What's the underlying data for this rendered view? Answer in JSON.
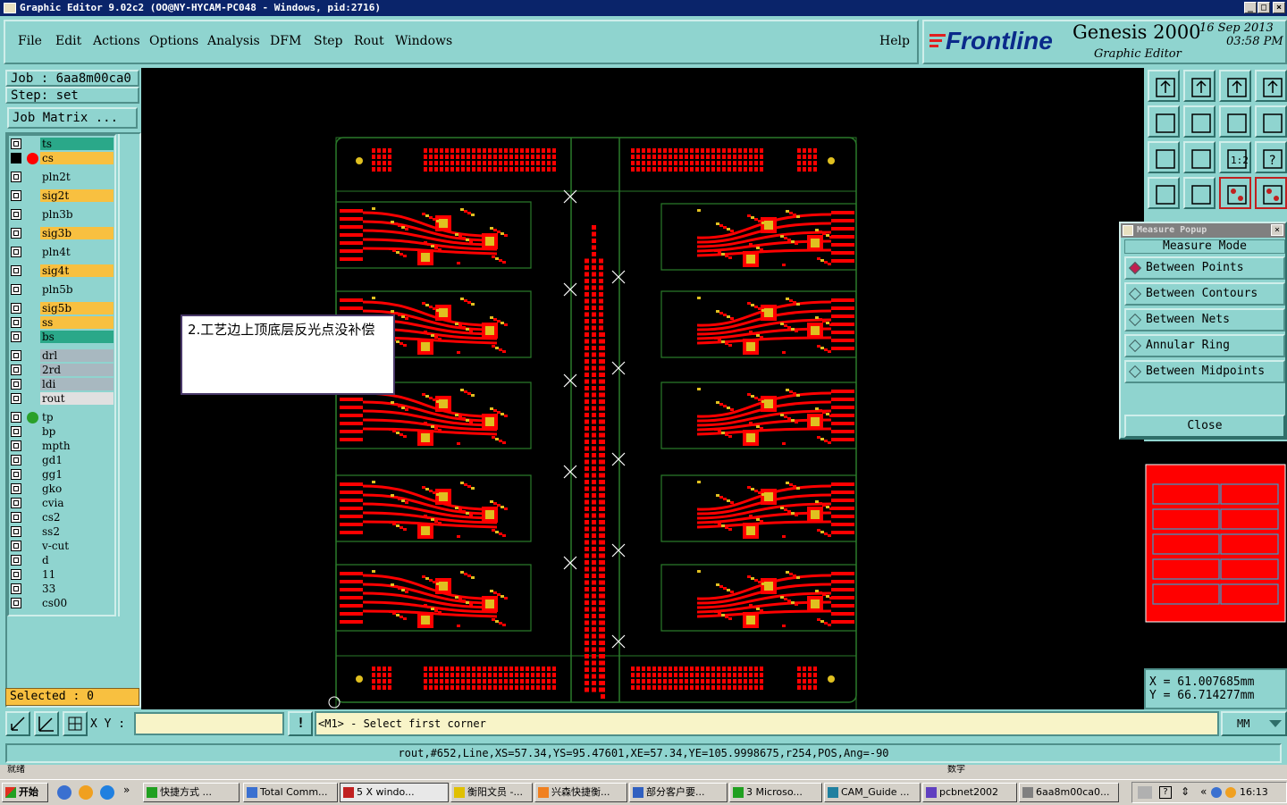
{
  "window": {
    "title": "Graphic Editor 9.02c2 (OO@NY-HYCAM-PC048 - Windows, pid:2716)"
  },
  "menu": [
    "File",
    "Edit",
    "Actions",
    "Options",
    "Analysis",
    "DFM",
    "Step",
    "Rout",
    "Windows"
  ],
  "menu_help": "Help",
  "brand": {
    "logo": "Frontline",
    "product": "Genesis 2000",
    "subtitle": "Graphic Editor",
    "date": "16 Sep 2013",
    "time": "03:58 PM"
  },
  "job": {
    "job_label": "Job : 6aa8m00ca0",
    "step_label": "Step: set",
    "matrix_button": "Job Matrix ..."
  },
  "layers": [
    {
      "name": "ts",
      "bg": "#2aa889",
      "dot": ""
    },
    {
      "name": "cs",
      "bg": "#f8c040",
      "dot": "#ff0000",
      "active": true
    },
    {
      "name": "pln2t",
      "bg": "#8fd4cf",
      "dot": ""
    },
    {
      "name": "sig2t",
      "bg": "#f8c040",
      "dot": ""
    },
    {
      "name": "pln3b",
      "bg": "#8fd4cf",
      "dot": ""
    },
    {
      "name": "sig3b",
      "bg": "#f8c040",
      "dot": ""
    },
    {
      "name": "pln4t",
      "bg": "#8fd4cf",
      "dot": ""
    },
    {
      "name": "sig4t",
      "bg": "#f8c040",
      "dot": ""
    },
    {
      "name": "pln5b",
      "bg": "#8fd4cf",
      "dot": ""
    },
    {
      "name": "sig5b",
      "bg": "#f8c040",
      "dot": ""
    },
    {
      "name": "ss",
      "bg": "#f8c040",
      "dot": ""
    },
    {
      "name": "bs",
      "bg": "#2aa889",
      "dot": ""
    },
    {
      "name": "drl",
      "bg": "#a8b8c0",
      "dot": ""
    },
    {
      "name": "2rd",
      "bg": "#a8b8c0",
      "dot": ""
    },
    {
      "name": "ldi",
      "bg": "#a8b8c0",
      "dot": ""
    },
    {
      "name": "rout",
      "bg": "#e0e0e0",
      "dot": ""
    },
    {
      "name": "tp",
      "bg": "#8fd4cf",
      "dot": "#2aa02a"
    },
    {
      "name": "bp",
      "bg": "#8fd4cf",
      "dot": ""
    },
    {
      "name": "mpth",
      "bg": "#8fd4cf",
      "dot": ""
    },
    {
      "name": "gd1",
      "bg": "#8fd4cf",
      "dot": ""
    },
    {
      "name": "gg1",
      "bg": "#8fd4cf",
      "dot": ""
    },
    {
      "name": "gko",
      "bg": "#8fd4cf",
      "dot": ""
    },
    {
      "name": "cvia",
      "bg": "#8fd4cf",
      "dot": ""
    },
    {
      "name": "cs2",
      "bg": "#8fd4cf",
      "dot": ""
    },
    {
      "name": "ss2",
      "bg": "#8fd4cf",
      "dot": ""
    },
    {
      "name": "v-cut",
      "bg": "#8fd4cf",
      "dot": ""
    },
    {
      "name": "d",
      "bg": "#8fd4cf",
      "dot": ""
    },
    {
      "name": "11",
      "bg": "#8fd4cf",
      "dot": ""
    },
    {
      "name": "33",
      "bg": "#8fd4cf",
      "dot": ""
    },
    {
      "name": "cs00",
      "bg": "#8fd4cf",
      "dot": ""
    }
  ],
  "selected": "Selected : 0",
  "annotation": "2.工艺边上顶底层反光点没补偿",
  "measure": {
    "title": "Measure Popup",
    "mode_label": "Measure Mode",
    "options": [
      "Between Points",
      "Between Contours",
      "Between Nets",
      "Annular Ring",
      "Between Midpoints"
    ],
    "selected_index": 0,
    "close_label": "Close"
  },
  "coords": {
    "x": "X  =  61.007685mm",
    "y": "Y  =  66.714277mm"
  },
  "command": {
    "xy_label": "X Y :",
    "xy_value": "",
    "prompt": "<M1> - Select first corner",
    "units": "MM"
  },
  "status": "rout,#652,Line,XS=57.34,YS=95.47601,XE=57.34,YE=105.9998675,r254,POS,Ang=-90",
  "under_status_left": "就绪",
  "under_status_right": "数字",
  "taskbar": {
    "start": "开始",
    "tasks": [
      "快捷方式 ...",
      "Total Comm...",
      "5 X windo...",
      "衡阳文员 -...",
      "兴森快捷衡...",
      "部分客户要...",
      "3 Microso...",
      "CAM_Guide ...",
      "pcbnet2002",
      "6aa8m00ca0..."
    ],
    "clock": "16:13"
  },
  "colors": {
    "board_red": "#ff0000",
    "pad_yellow": "#e0c020",
    "outline_green": "#2a7a2a",
    "panel": "#8fd4cf"
  }
}
